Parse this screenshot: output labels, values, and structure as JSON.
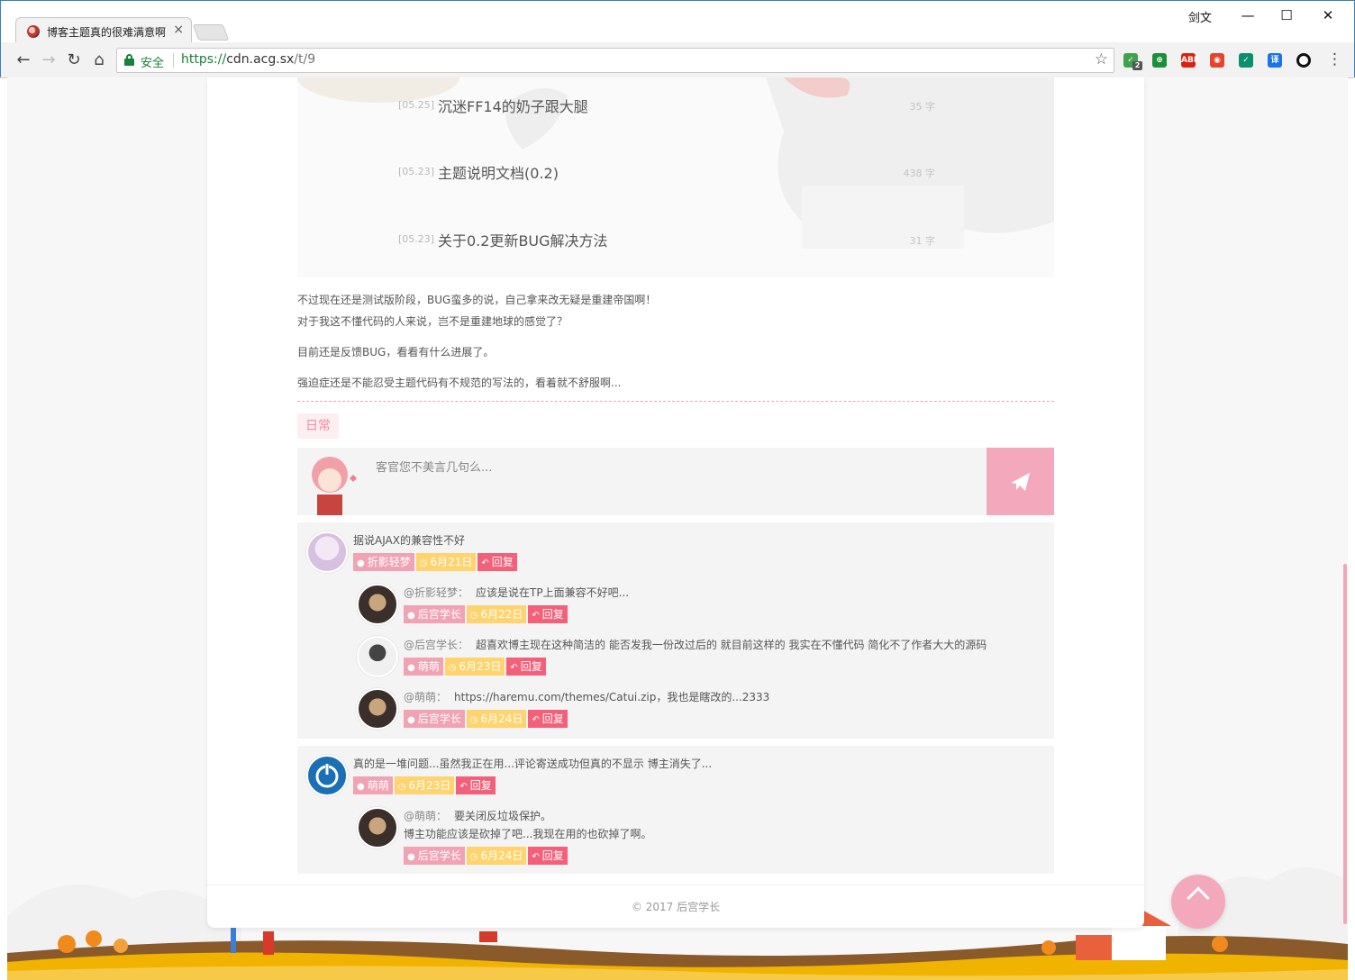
{
  "browser": {
    "tab_title": "博客主题真的很难满意啊",
    "tab_close": "×",
    "user_label": "剑文",
    "window_controls": {
      "minimize": "—",
      "maximize": "☐",
      "close": "✕"
    },
    "nav": {
      "back": "←",
      "forward": "→",
      "reload": "↻",
      "home": "⌂"
    },
    "security_label": "安全",
    "url": {
      "scheme": "https://",
      "host": "cdn.acg.sx",
      "path": "/t/9"
    },
    "bookmark_icon": "☆",
    "extensions": [
      {
        "name": "shield-check-icon",
        "label": "✓",
        "color": "#3fa34d",
        "badge": "2"
      },
      {
        "name": "privacy-badge-icon",
        "label": "⊕",
        "color": "#1b8f3a"
      },
      {
        "name": "adblock-plus-icon",
        "label": "ABP",
        "color": "#d9230f"
      },
      {
        "name": "weibo-icon",
        "label": "◉",
        "color": "#e6432d"
      },
      {
        "name": "security-shield-icon",
        "label": "✓",
        "color": "#0c8f6b"
      },
      {
        "name": "translate-icon",
        "label": "译",
        "color": "#1a73e8"
      },
      {
        "name": "circle-extension-icon",
        "label": "",
        "color": "#111111"
      }
    ],
    "menu": "⋮"
  },
  "posts": [
    {
      "date": "[05.25]",
      "title": "沉迷FF14的奶子跟大腿",
      "count": "35 字"
    },
    {
      "date": "[05.23]",
      "title": "主题说明文档(0.2)",
      "count": "438 字"
    },
    {
      "date": "[05.23]",
      "title": "关于0.2更新BUG解决方法",
      "count": "31 字"
    }
  ],
  "article": {
    "lines": [
      "不过现在还是测试版阶段，BUG蛮多的说，自己拿来改无疑是重建帝国啊！",
      "对于我这不懂代码的人来说，岂不是重建地球的感觉了？",
      "目前还是反馈BUG，看看有什么进展了。",
      "强迫症还是不能忍受主题代码有不规范的写法的，看着就不舒服啊..."
    ],
    "tag": "日常"
  },
  "comment_form": {
    "placeholder": "客官您不美言几句么..."
  },
  "threads": [
    {
      "text": "据说AJAX的兼容性不好",
      "user": "折影轻梦",
      "date": "6月21日",
      "reply": "回复",
      "replies": [
        {
          "at": "@折影轻梦：",
          "text": "应该是说在TP上面兼容不好吧...",
          "user": "后宫学长",
          "date": "6月22日",
          "reply": "回复"
        },
        {
          "at": "@后宫学长：",
          "text": "超喜欢博主现在这种简洁的 能否发我一份改过后的 就目前这样的 我实在不懂代码 简化不了作者大大的源码",
          "user": "萌萌",
          "date": "6月23日",
          "reply": "回复"
        },
        {
          "at": "@萌萌：",
          "text": "https://haremu.com/themes/Catui.zip，我也是瞎改的...2333",
          "user": "后宫学长",
          "date": "6月24日",
          "reply": "回复"
        }
      ]
    },
    {
      "text": "真的是一堆问题...虽然我正在用...评论寄送成功但真的不显示 博主消失了...",
      "user": "萌萌",
      "date": "6月23日",
      "reply": "回复",
      "replies": [
        {
          "at": "@萌萌：",
          "text": "要关闭反垃圾保护。",
          "text2": "博主功能应该是砍掉了吧...我现在用的也砍掉了啊。",
          "user": "后宫学长",
          "date": "6月24日",
          "reply": "回复"
        }
      ]
    }
  ],
  "footer": {
    "copyright": "© 2017 后宫学长"
  },
  "colors": {
    "accent_pink": "#f3a9bb",
    "reply_red": "#f4607a",
    "date_yellow": "#ffd36e",
    "secure_green": "#188038"
  }
}
